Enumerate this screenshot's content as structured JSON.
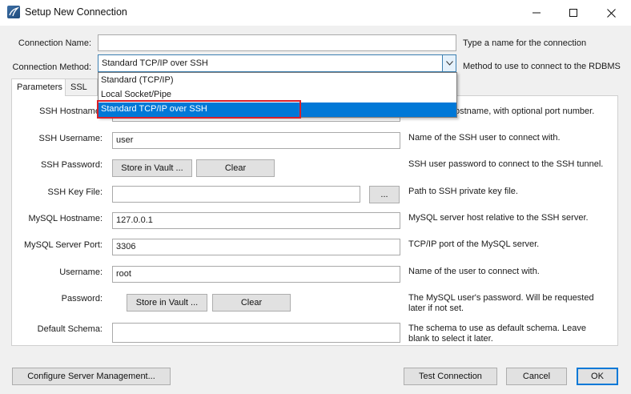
{
  "window": {
    "title": "Setup New Connection",
    "icon": "mysql-workbench-icon"
  },
  "connection_name": {
    "label": "Connection Name:",
    "value": "",
    "hint": "Type a name for the connection"
  },
  "connection_method": {
    "label": "Connection Method:",
    "selected": "Standard TCP/IP over SSH",
    "hint": "Method to use to connect to the RDBMS",
    "options": [
      "Standard (TCP/IP)",
      "Local Socket/Pipe",
      "Standard TCP/IP over SSH"
    ],
    "highlighted_option": "Standard TCP/IP over SSH"
  },
  "tabs": [
    {
      "label": "Parameters",
      "active": true
    },
    {
      "label": "SSL",
      "active": false
    }
  ],
  "fields": {
    "ssh_hostname": {
      "label": "SSH Hostname:",
      "value": "",
      "hint": "ostname, with  optional port number."
    },
    "ssh_username": {
      "label": "SSH Username:",
      "value": "user",
      "hint": "Name of the SSH user to connect with."
    },
    "ssh_password": {
      "label": "SSH Password:",
      "store_label": "Store in Vault ...",
      "clear_label": "Clear",
      "hint": "SSH user password to connect to the SSH tunnel."
    },
    "ssh_key_file": {
      "label": "SSH Key File:",
      "value": "",
      "browse_label": "...",
      "hint": "Path to SSH private key file."
    },
    "mysql_hostname": {
      "label": "MySQL Hostname:",
      "value": "127.0.0.1",
      "hint": "MySQL server host relative to the SSH server."
    },
    "mysql_port": {
      "label": "MySQL Server Port:",
      "value": "3306",
      "hint": "TCP/IP port of the MySQL server."
    },
    "username": {
      "label": "Username:",
      "value": "root",
      "hint": "Name of the user to connect with."
    },
    "password": {
      "label": "Password:",
      "store_label": "Store in Vault ...",
      "clear_label": "Clear",
      "hint_line1": "The MySQL user's password. Will be requested",
      "hint_line2": "later if not set."
    },
    "default_schema": {
      "label": "Default Schema:",
      "value": "",
      "hint_line1": "The schema to use as default schema. Leave",
      "hint_line2": "blank to select it later."
    }
  },
  "footer": {
    "configure_label": "Configure Server Management...",
    "test_label": "Test Connection",
    "cancel_label": "Cancel",
    "ok_label": "OK"
  },
  "colors": {
    "accent": "#0078d7",
    "highlight_border": "#d9202a"
  }
}
